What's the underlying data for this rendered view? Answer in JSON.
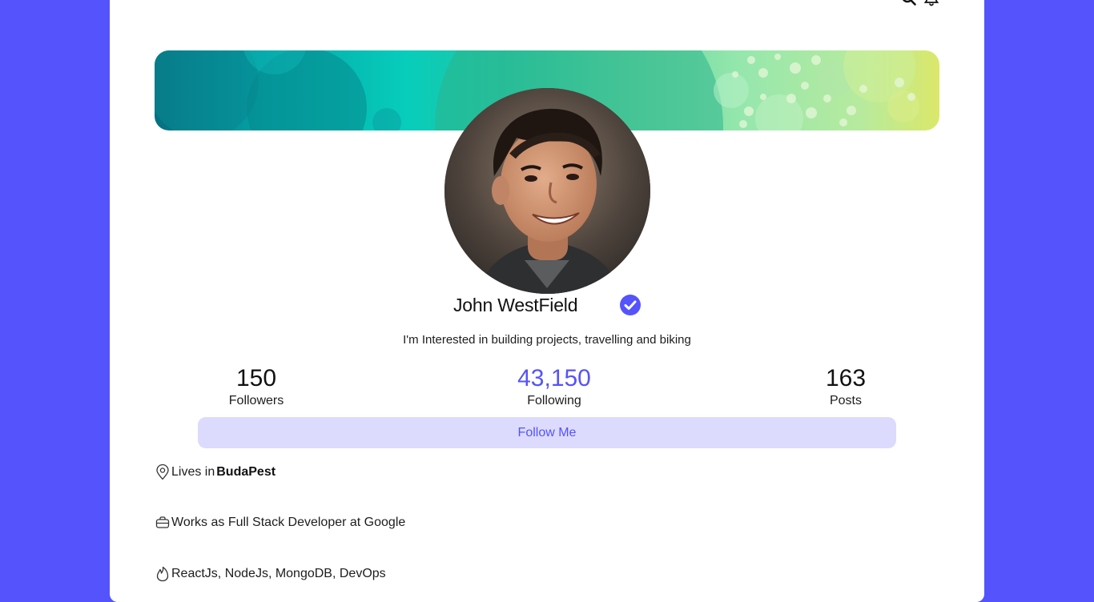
{
  "profile": {
    "name": "John WestField",
    "bio": "I'm Interested in building projects, travelling and biking",
    "follow_label": "Follow Me"
  },
  "stats": [
    {
      "value": "150",
      "label": "Followers"
    },
    {
      "value": "43,150",
      "label": "Following"
    },
    {
      "value": "163",
      "label": "Posts"
    }
  ],
  "details": {
    "location_prefix": "Lives in",
    "location": "BudaPest",
    "work": "Works as Full Stack Developer at Google",
    "skills": "ReactJs, NodeJs, MongoDB, DevOps"
  },
  "icons": {
    "search": "search-icon",
    "notifications": "bell-icon",
    "verified": "verified-badge-icon",
    "location": "location-pin-icon",
    "work": "briefcase-icon",
    "skills": "flame-icon"
  },
  "colors": {
    "background": "#5553fb",
    "accent": "#5553fb",
    "button_bg": "#dcdbfd"
  }
}
